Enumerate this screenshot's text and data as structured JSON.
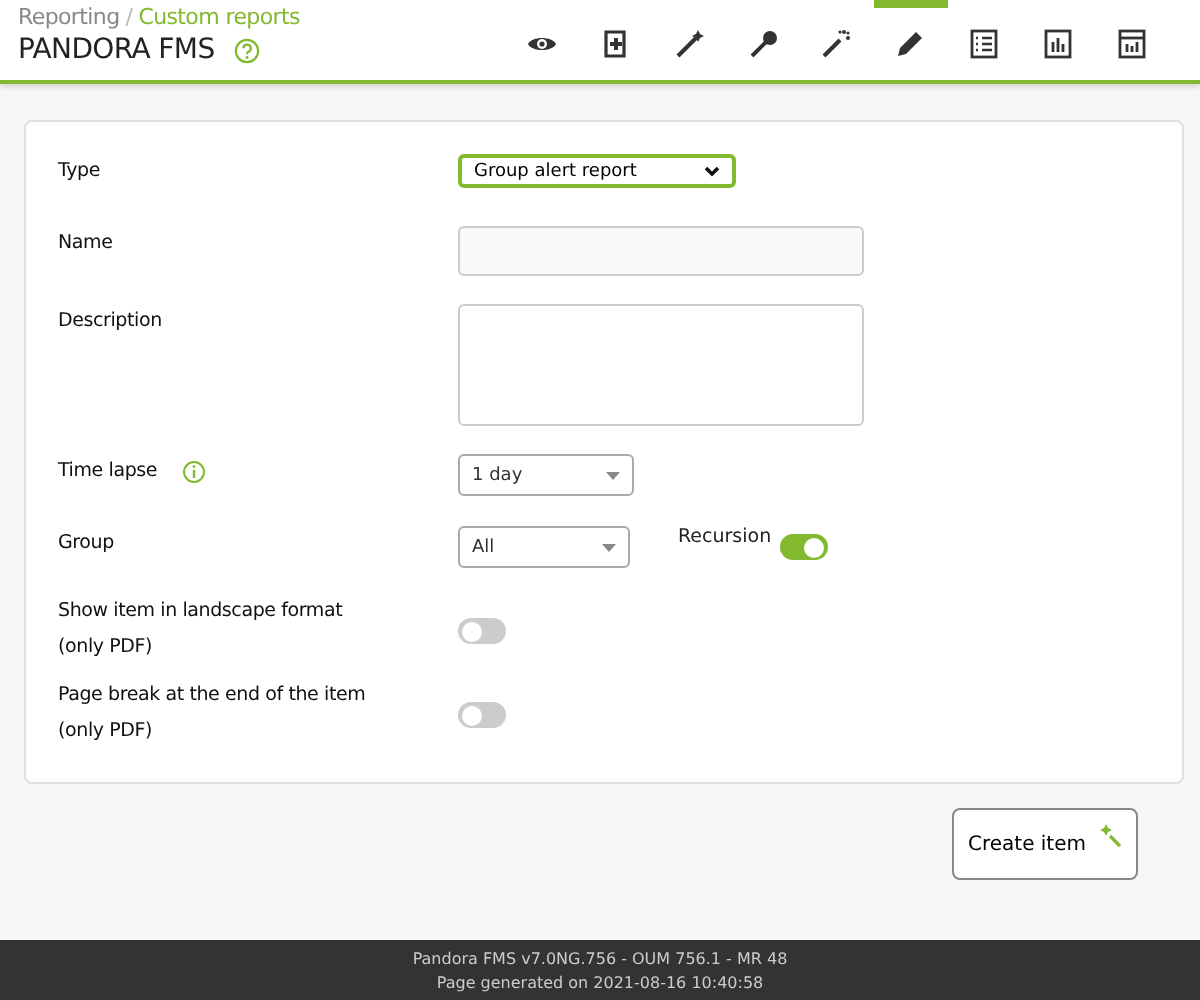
{
  "breadcrumb": [
    {
      "label": "Reporting",
      "current": false
    },
    {
      "label": "Custom reports",
      "current": true
    }
  ],
  "breadcrumb_separator": "/",
  "title": "PANDORA FMS",
  "toolbar": [
    {
      "kind": "eye",
      "selected": false
    },
    {
      "kind": "add",
      "selected": false
    },
    {
      "kind": "wand",
      "selected": false
    },
    {
      "kind": "pin",
      "selected": false
    },
    {
      "kind": "sparkle",
      "selected": false
    },
    {
      "kind": "pencil",
      "selected": true
    },
    {
      "kind": "list",
      "selected": false
    },
    {
      "kind": "chart",
      "selected": false
    },
    {
      "kind": "panel",
      "selected": false
    }
  ],
  "form": [
    {
      "kind": "select",
      "label": "Type",
      "value": "Group alert report",
      "focused": true
    },
    {
      "kind": "text",
      "label": "Name"
    },
    {
      "kind": "textarea",
      "label": "Description"
    },
    {
      "kind": "dropdown",
      "label": "Time lapse",
      "info": true,
      "value": "1 day"
    },
    {
      "kind": "dropdown",
      "label": "Group",
      "value": "All",
      "extra": {
        "label": "Recursion",
        "on": true
      }
    },
    {
      "kind": "toggle",
      "label": "Show item in landscape format (only PDF)",
      "on": false
    },
    {
      "kind": "toggle",
      "label": "Page break at the end of the item (only PDF)",
      "on": false
    }
  ],
  "create_button": "Create item",
  "footer": [
    "Pandora FMS v7.0NG.756 - OUM 756.1 - MR 48",
    "Page generated on 2021-08-16 10:40:58"
  ]
}
